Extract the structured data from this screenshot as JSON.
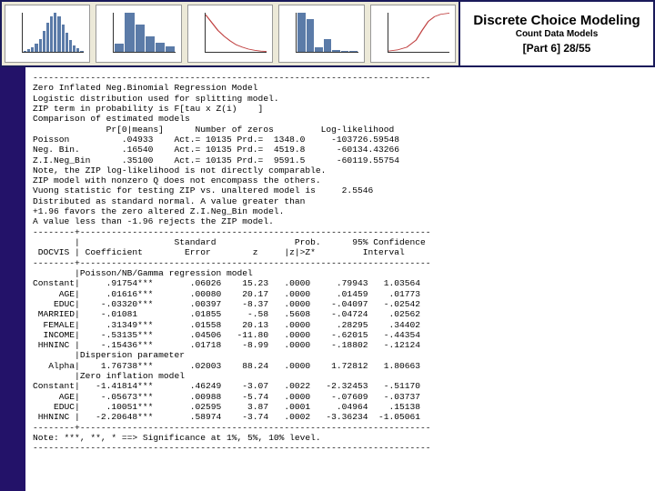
{
  "title": {
    "main": "Discrete Choice Modeling",
    "sub": "Count Data Models",
    "part": "[Part 6]   28/55"
  },
  "charts": [
    {
      "type": "bar",
      "values": [
        2,
        4,
        7,
        12,
        20,
        32,
        44,
        54,
        60,
        55,
        42,
        30,
        18,
        10,
        5,
        2
      ]
    },
    {
      "type": "bar",
      "values": [
        0.18,
        0.9,
        0.62,
        0.35,
        0.2,
        0.12
      ]
    },
    {
      "type": "line",
      "points": [
        [
          0,
          0.95
        ],
        [
          0.1,
          0.75
        ],
        [
          0.2,
          0.55
        ],
        [
          0.3,
          0.4
        ],
        [
          0.4,
          0.28
        ],
        [
          0.5,
          0.18
        ],
        [
          0.6,
          0.12
        ],
        [
          0.7,
          0.07
        ],
        [
          0.8,
          0.04
        ],
        [
          0.9,
          0.02
        ],
        [
          1,
          0.01
        ]
      ]
    },
    {
      "type": "bar",
      "values": [
        0.95,
        0.8,
        0.1,
        0.3,
        0.04,
        0.02,
        0.02
      ]
    },
    {
      "type": "cdf",
      "points": [
        [
          0,
          0.02
        ],
        [
          0.15,
          0.05
        ],
        [
          0.3,
          0.12
        ],
        [
          0.45,
          0.3
        ],
        [
          0.55,
          0.55
        ],
        [
          0.65,
          0.78
        ],
        [
          0.75,
          0.9
        ],
        [
          0.85,
          0.96
        ],
        [
          1,
          0.99
        ]
      ]
    }
  ],
  "output": "----------------------------------------------------------------------------\nZero Inflated Neg.Binomial Regression Model\nLogistic distribution used for splitting model.\nZIP term in probability is F[tau x Z(i)    ]\nComparison of estimated models\n              Pr[0|means]      Number of zeros         Log-likelihood\nPoisson          .04933    Act.= 10135 Prd.=  1348.0     -103726.59548\nNeg. Bin.        .16540    Act.= 10135 Prd.=  4519.8      -60134.43266\nZ.I.Neg_Bin      .35100    Act.= 10135 Prd.=  9591.5      -60119.55754\nNote, the ZIP log-likelihood is not directly comparable.\nZIP model with nonzero Q does not encompass the others.\nVuong statistic for testing ZIP vs. unaltered model is     2.5546\nDistributed as standard normal. A value greater than\n+1.96 favors the zero altered Z.I.Neg_Bin model.\nA value less than -1.96 rejects the ZIP model.\n--------+-------------------------------------------------------------------\n        |                  Standard               Prob.      95% Confidence\n DOCVIS | Coefficient        Error        z     |z|>Z*         Interval\n--------+-------------------------------------------------------------------\n        |Poisson/NB/Gamma regression model\nConstant|     .91754***       .06026    15.23   .0000     .79943   1.03564\n     AGE|     .01616***       .00080    20.17   .0000     .01459    .01773\n    EDUC|    -.03320***       .00397    -8.37   .0000    -.04097   -.02542\n MARRIED|    -.01081          .01855     -.58   .5608    -.04724    .02562\n  FEMALE|     .31349***       .01558    20.13   .0000     .28295    .34402\n  INCOME|    -.53135***       .04506   -11.80   .0000    -.62015   -.44354\n HHNINC |    -.15436***       .01718    -8.99   .0000    -.18802   -.12124\n        |Dispersion parameter\n   Alpha|    1.76738***       .02003    88.24   .0000    1.72812   1.80663\n        |Zero inflation model\nConstant|   -1.41814***       .46249    -3.07   .0022   -2.32453   -.51170\n     AGE|    -.05673***       .00988    -5.74   .0000    -.07609   -.03737\n    EDUC|     .10051***       .02595     3.87   .0001     .04964    .15138\n HHNINC |   -2.20648***       .58974    -3.74   .0002   -3.36234  -1.05061\n--------+-------------------------------------------------------------------\nNote: ***, **, * ==> Significance at 1%, 5%, 10% level.\n----------------------------------------------------------------------------"
}
